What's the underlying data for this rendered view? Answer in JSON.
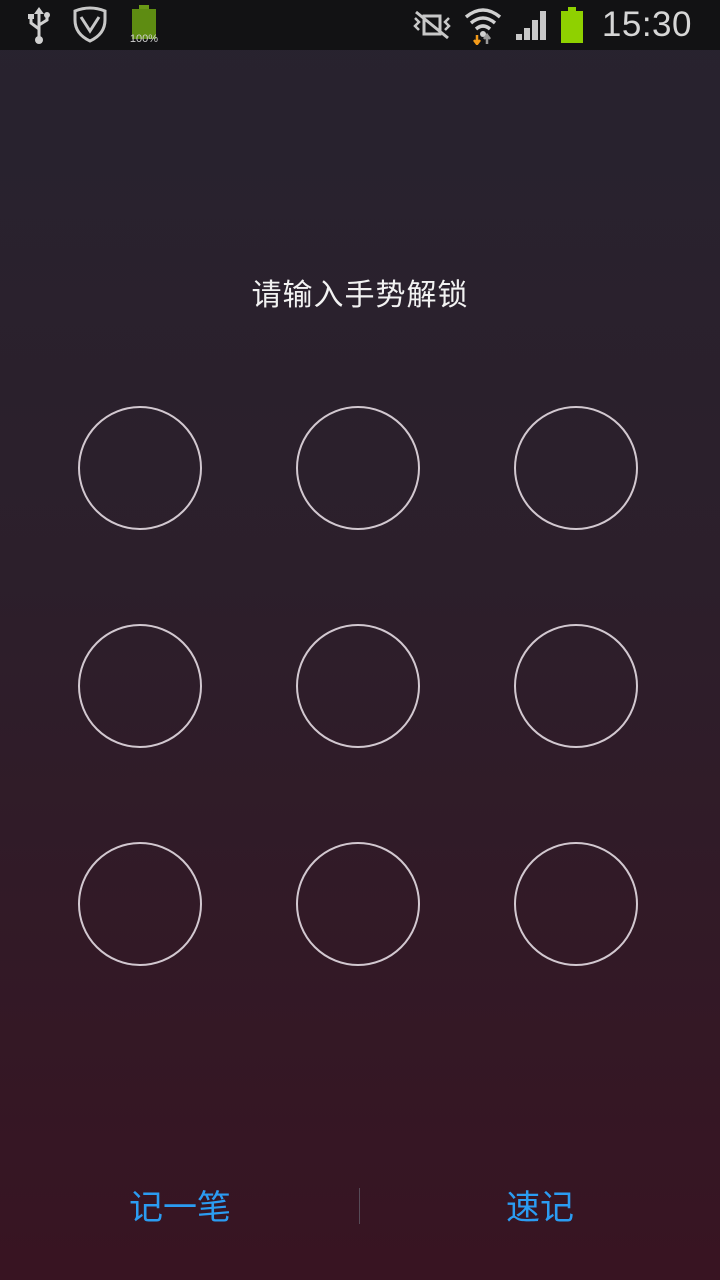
{
  "status_bar": {
    "time": "15:30",
    "battery_small_pct": "100%",
    "icons": [
      "usb-icon",
      "shield-icon",
      "battery-small-icon",
      "vibrate-mute-icon",
      "wifi-icon",
      "signal-icon",
      "battery-icon"
    ],
    "battery_color": "#8fd100"
  },
  "prompt": "请输入手势解锁",
  "pattern": {
    "rows": 3,
    "cols": 3,
    "ring_color": "#d2c8d0"
  },
  "actions": {
    "left_label": "记一笔",
    "right_label": "速记",
    "accent": "#2b9cf2"
  }
}
